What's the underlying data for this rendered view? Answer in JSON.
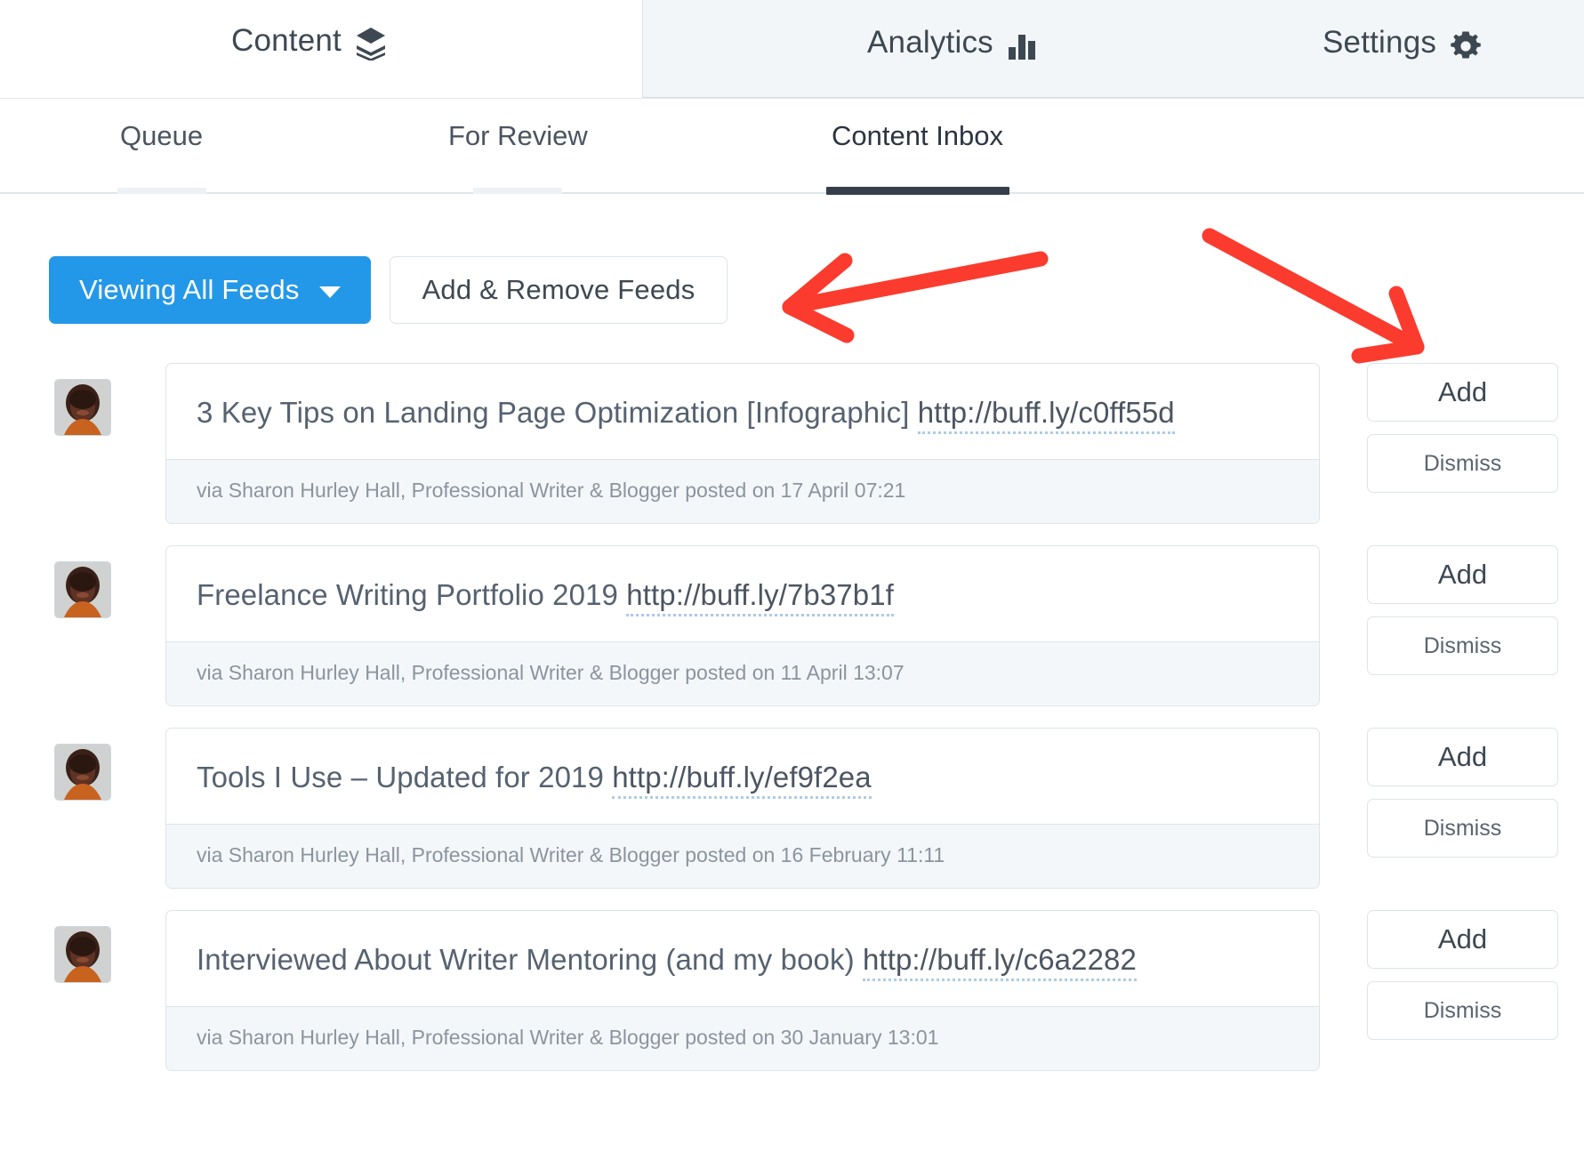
{
  "topnav": {
    "items": [
      {
        "label": "Content",
        "icon": "layers-icon"
      },
      {
        "label": "Analytics",
        "icon": "bar-chart-icon"
      },
      {
        "label": "Settings",
        "icon": "gear-icon"
      }
    ]
  },
  "subtabs": {
    "items": [
      {
        "label": "Queue",
        "active": false
      },
      {
        "label": "For Review",
        "active": false
      },
      {
        "label": "Content Inbox",
        "active": true
      }
    ]
  },
  "toolbar": {
    "feeds_button_label": "Viewing All Feeds",
    "add_remove_label": "Add & Remove Feeds"
  },
  "actions": {
    "add_label": "Add",
    "dismiss_label": "Dismiss"
  },
  "feed": {
    "items": [
      {
        "title": "3 Key Tips on Landing Page Optimization [Infographic] ",
        "link": "http://buff.ly/c0ff55d",
        "meta": "via Sharon Hurley Hall, Professional Writer & Blogger posted on 17 April 07:21"
      },
      {
        "title": "Freelance Writing Portfolio 2019 ",
        "link": "http://buff.ly/7b37b1f",
        "meta": "via Sharon Hurley Hall, Professional Writer & Blogger posted on 11 April 13:07"
      },
      {
        "title": "Tools I Use – Updated for 2019 ",
        "link": "http://buff.ly/ef9f2ea",
        "meta": "via Sharon Hurley Hall, Professional Writer & Blogger posted on 16 February 11:11"
      },
      {
        "title": "Interviewed About Writer Mentoring (and my book) ",
        "link": "http://buff.ly/c6a2282",
        "meta": "via Sharon Hurley Hall, Professional Writer & Blogger posted on 30 January 13:01"
      }
    ]
  },
  "annotations": {
    "arrows": [
      {
        "name": "arrow-pointing-to-add-remove-feeds",
        "direction": "left"
      },
      {
        "name": "arrow-pointing-to-add-button",
        "direction": "down-right"
      }
    ],
    "color": "#fb3b2e"
  },
  "colors": {
    "accent_blue": "#2498e8",
    "active_tab_underline": "#343f4b",
    "panel_bg": "#f3f6f8",
    "meta_bg": "#f4f7f9",
    "border": "#dde4ea",
    "annotation_red": "#fb3b2e"
  }
}
